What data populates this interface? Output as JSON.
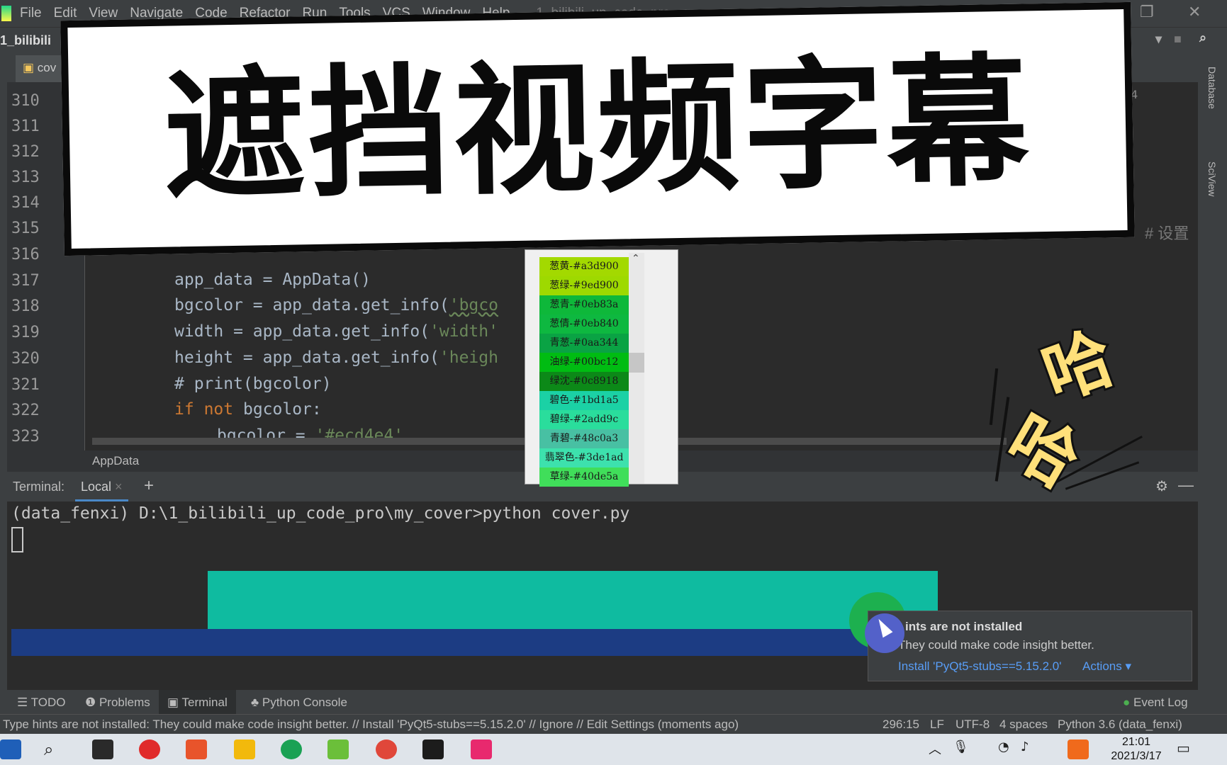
{
  "menubar": {
    "items": [
      "File",
      "Edit",
      "View",
      "Navigate",
      "Code",
      "Refactor",
      "Run",
      "Tools",
      "VCS",
      "Window",
      "Help"
    ],
    "window_title": "1_bilibili_up_code_pro - cover.py"
  },
  "navbar": {
    "project": "1_bilibili"
  },
  "tabbar": {
    "active_tab": "cov"
  },
  "side_tools": {
    "right_top": "Database",
    "right_bottom": "SciView"
  },
  "editor": {
    "line_numbers": [
      "310",
      "311",
      "312",
      "313",
      "314",
      "315",
      "316",
      "317",
      "318",
      "319",
      "320",
      "321",
      "322",
      "323"
    ],
    "code": {
      "l317": "app_data = AppData()",
      "l318_a": "bgcolor = app_data.get_info(",
      "l318_b": "'bgco",
      "l319_a": "width = app_data.get_info(",
      "l319_b": "'width'",
      "l320_a": "height = app_data.get_info(",
      "l320_b": "'heigh",
      "l321": "# print(bgcolor)",
      "l322_kw1": "if",
      "l322_kw2": "not",
      "l322_rest": "bgcolor:",
      "l323_a": "bgcolor = ",
      "l323_b": "'#ecd4e4'"
    },
    "right_comment": "#  设置",
    "line_counter": "24"
  },
  "breadcrumb": "AppData",
  "terminal": {
    "label": "Terminal:",
    "tab": "Local",
    "prompt": "(data_fenxi) D:\\1_bilibili_up_code_pro\\my_cover>python cover.py"
  },
  "color_list": [
    {
      "label": "葱黄-#a3d900",
      "color": "#a3d900"
    },
    {
      "label": "葱绿-#9ed900",
      "color": "#9ed900"
    },
    {
      "label": "葱青-#0eb83a",
      "color": "#0eb83a"
    },
    {
      "label": "葱倩-#0eb840",
      "color": "#0eb840"
    },
    {
      "label": "青葱-#0aa344",
      "color": "#0aa344"
    },
    {
      "label": "油绿-#00bc12",
      "color": "#00bc12"
    },
    {
      "label": "绿沈-#0c8918",
      "color": "#0c8918"
    },
    {
      "label": "碧色-#1bd1a5",
      "color": "#1bd1a5"
    },
    {
      "label": "碧绿-#2add9c",
      "color": "#2add9c"
    },
    {
      "label": "青碧-#48c0a3",
      "color": "#48c0a3"
    },
    {
      "label": "翡翠色-#3de1ad",
      "color": "#3de1ad"
    },
    {
      "label": "草绿-#40de5a",
      "color": "#40de5a"
    }
  ],
  "notification": {
    "title": "ints are not installed",
    "body": "They could make code insight better.",
    "install": "Install 'PyQt5-stubs==5.15.2.0'",
    "actions": "Actions ▾"
  },
  "bottom_tools": {
    "todo": "TODO",
    "problems": "Problems",
    "terminal": "Terminal",
    "python_console": "Python Console",
    "event_log": "Event Log"
  },
  "statusbar": {
    "message": "Type hints are not installed: They could make code insight better. // Install 'PyQt5-stubs==5.15.2.0' // Ignore // Edit Settings (moments ago)",
    "position": "296:15",
    "line_sep": "LF",
    "encoding": "UTF-8",
    "indent": "4 spaces",
    "interpreter": "Python 3.6 (data_fenxi)"
  },
  "taskbar": {
    "time": "21:01",
    "date": "2021/3/17"
  },
  "overlay": {
    "title": "遮挡视频字幕",
    "haha1": "哈",
    "haha2": "哈"
  },
  "colors": {
    "teal_rect": "#0fbba0",
    "blue_bar": "#1c3c83",
    "accent_link": "#589df6"
  }
}
